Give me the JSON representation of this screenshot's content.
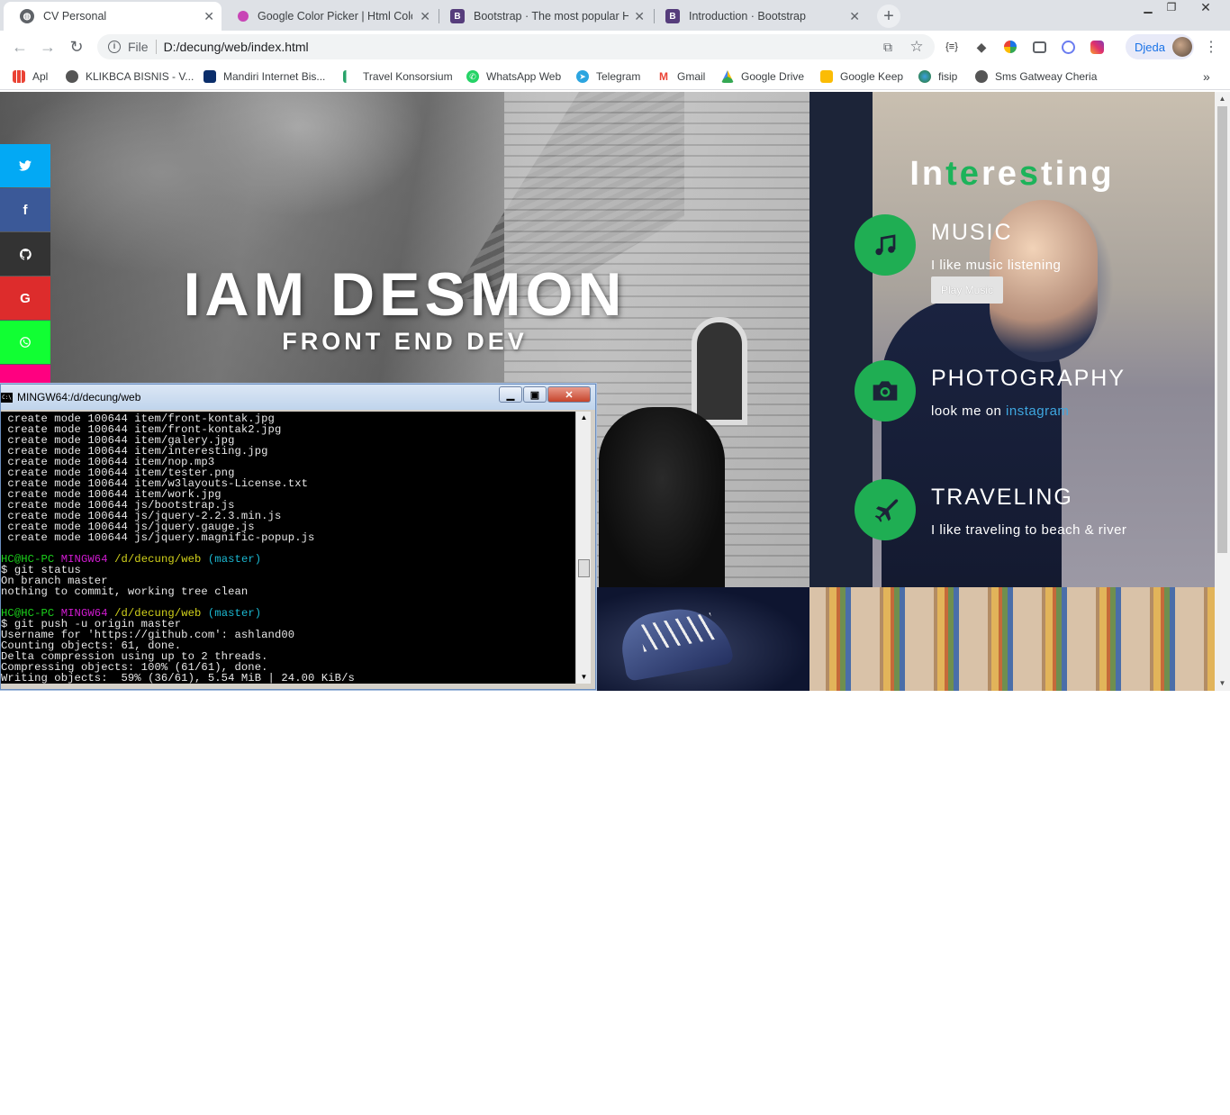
{
  "tabs": [
    {
      "title": "CV Personal",
      "favicon": "globe-icon",
      "color": "#5f6368",
      "active": true
    },
    {
      "title": "Google Color Picker | Html Color",
      "favicon": "color-picker-icon",
      "color": "#c845b6"
    },
    {
      "title": "Bootstrap · The most popular HT",
      "favicon": "bootstrap-icon",
      "color": "#563d7c"
    },
    {
      "title": "Introduction · Bootstrap",
      "favicon": "bootstrap-icon",
      "color": "#563d7c"
    }
  ],
  "address_bar": {
    "scheme_label": "File",
    "url": "D:/decung/web/index.html"
  },
  "profile": {
    "name": "Djeda"
  },
  "bookmarks": [
    {
      "label": "Apl",
      "icon": "apps-grid-icon"
    },
    {
      "label": "KLIKBCA BISNIS - V...",
      "icon": "globe-icon"
    },
    {
      "label": "Mandiri Internet Bis...",
      "icon": "mandiri-icon"
    },
    {
      "label": "Travel Konsorsium",
      "icon": "bar-signal-icon"
    },
    {
      "label": "WhatsApp Web",
      "icon": "whatsapp-icon"
    },
    {
      "label": "Telegram",
      "icon": "telegram-icon"
    },
    {
      "label": "Gmail",
      "icon": "gmail-icon"
    },
    {
      "label": "Google Drive",
      "icon": "drive-icon"
    },
    {
      "label": "Google Keep",
      "icon": "keep-icon"
    },
    {
      "label": "fisip",
      "icon": "earth-icon"
    },
    {
      "label": "Sms Gatweay Cheria",
      "icon": "globe-icon"
    }
  ],
  "hero": {
    "title": "IAM DESMON",
    "subtitle": "FRONT END DEV"
  },
  "social": [
    {
      "name": "twitter",
      "glyph": "🐦",
      "color": "#03a9f4"
    },
    {
      "name": "facebook",
      "glyph": "f",
      "color": "#3b5998"
    },
    {
      "name": "github",
      "glyph": "●",
      "color": "#333333"
    },
    {
      "name": "google",
      "glyph": "G",
      "color": "#dd2c2c"
    },
    {
      "name": "whatsapp",
      "glyph": "✆",
      "color": "#11ff33"
    },
    {
      "name": "instagram",
      "glyph": "",
      "color": "#ff0080"
    }
  ],
  "interesting": {
    "title_parts": [
      "In",
      "te",
      "re",
      "s",
      "ting"
    ],
    "items": [
      {
        "heading": "MUSIC",
        "text": "I like music listening",
        "button": "Play Music",
        "icon": "music-note-icon"
      },
      {
        "heading": "PHOTOGRAPHY",
        "text": "look me on",
        "link": "instagram",
        "icon": "camera-icon"
      },
      {
        "heading": "TRAVELING",
        "text": "I like traveling to beach & river",
        "icon": "airplane-icon"
      }
    ],
    "accent": "#1fae53"
  },
  "terminal": {
    "title": "MINGW64:/d/decung/web",
    "lines": [
      " create mode 100644 item/front-kontak.jpg",
      " create mode 100644 item/front-kontak2.jpg",
      " create mode 100644 item/galery.jpg",
      " create mode 100644 item/interesting.jpg",
      " create mode 100644 item/nop.mp3",
      " create mode 100644 item/tester.png",
      " create mode 100644 item/w3layouts-License.txt",
      " create mode 100644 item/work.jpg",
      " create mode 100644 js/bootstrap.js",
      " create mode 100644 js/jquery-2.2.3.min.js",
      " create mode 100644 js/jquery.gauge.js",
      " create mode 100644 js/jquery.magnific-popup.js",
      "",
      "PROMPT1",
      "$ git status",
      "On branch master",
      "nothing to commit, working tree clean",
      "",
      "PROMPT2",
      "$ git push -u origin master",
      "Username for 'https://github.com': ashland00",
      "Counting objects: 61, done.",
      "Delta compression using up to 2 threads.",
      "Compressing objects: 100% (61/61), done.",
      "Writing objects:  59% (36/61), 5.54 MiB | 24.00 KiB/s"
    ],
    "prompt": {
      "user": "HC@HC-PC",
      "shell": "MINGW64",
      "path": "/d/decung/web",
      "branch": "(master)"
    }
  }
}
